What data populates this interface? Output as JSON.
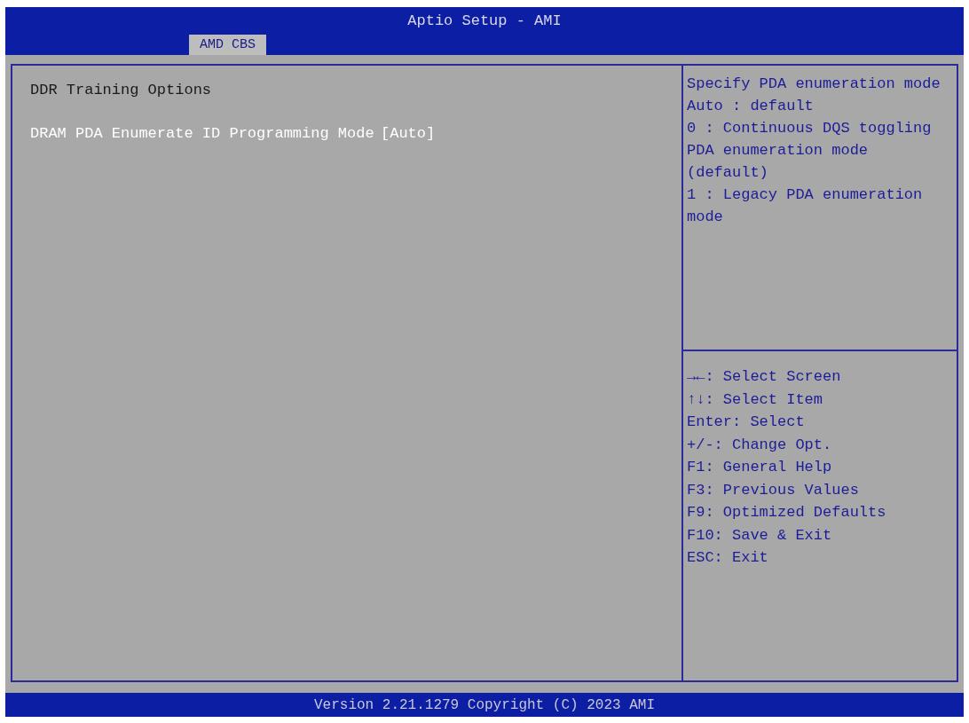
{
  "window": {
    "title": "Aptio Setup - AMI"
  },
  "tabs": [
    {
      "label": "AMD CBS",
      "selected": true
    }
  ],
  "main": {
    "heading": "DDR Training Options",
    "items": [
      {
        "label": "DRAM PDA Enumerate ID Programming Mode",
        "value": "[Auto]",
        "selected": true
      }
    ]
  },
  "help": {
    "lines": [
      "Specify PDA enumeration mode",
      "Auto : default",
      "0 : Continuous DQS toggling PDA enumeration mode (default)",
      "1 : Legacy PDA enumeration mode"
    ]
  },
  "keys": [
    "→←: Select Screen",
    "↑↓: Select Item",
    "Enter: Select",
    "+/-: Change Opt.",
    "F1: General Help",
    "F3: Previous Values",
    "F9: Optimized Defaults",
    "F10: Save & Exit",
    "ESC: Exit"
  ],
  "status_bar": "Version 2.21.1279 Copyright (C) 2023 AMI"
}
